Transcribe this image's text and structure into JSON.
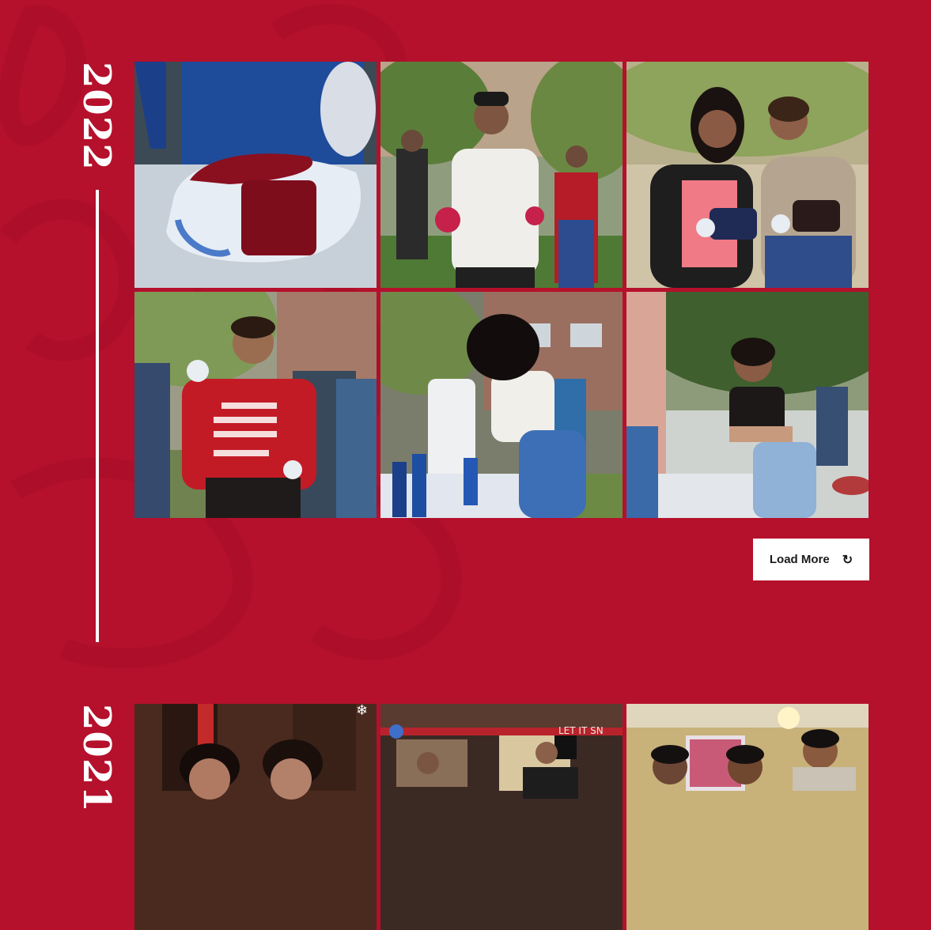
{
  "colors": {
    "background": "#b5102c",
    "line": "#ffffff",
    "button_bg": "#ffffff",
    "button_text": "#1a1a1a"
  },
  "sections": [
    {
      "year": "2022",
      "photos": [
        {
          "icon": "tie-dye-shirt-photo"
        },
        {
          "icon": "student-with-tie-dye-photo"
        },
        {
          "icon": "two-students-photo"
        },
        {
          "icon": "student-bulldogs-shirt-photo"
        },
        {
          "icon": "student-dyeing-shirt-photo"
        },
        {
          "icon": "student-at-table-photo"
        }
      ],
      "load_more": {
        "label": "Load More",
        "icon": "↻"
      }
    },
    {
      "year": "2021",
      "photos": [
        {
          "icon": "holiday-students-photo"
        },
        {
          "icon": "holiday-party-photo"
        },
        {
          "icon": "students-group-photo"
        }
      ]
    }
  ]
}
